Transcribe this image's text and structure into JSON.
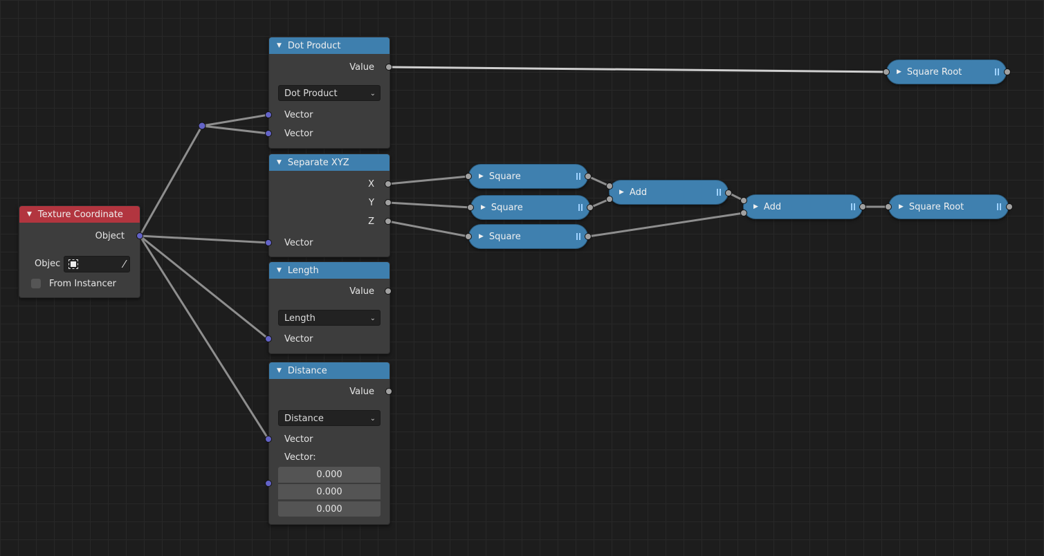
{
  "texture_coordinate": {
    "title": "Texture Coordinate",
    "output_object": "Object",
    "object_label": "Objec",
    "from_instancer_label": "From Instancer",
    "from_instancer_checked": false
  },
  "dot_product": {
    "title": "Dot Product",
    "output_value": "Value",
    "operation": "Dot Product",
    "input_vector_1": "Vector",
    "input_vector_2": "Vector"
  },
  "separate_xyz": {
    "title": "Separate XYZ",
    "out_x": "X",
    "out_y": "Y",
    "out_z": "Z",
    "input_vector": "Vector"
  },
  "length": {
    "title": "Length",
    "output_value": "Value",
    "operation": "Length",
    "input_vector": "Vector"
  },
  "distance": {
    "title": "Distance",
    "output_value": "Value",
    "operation": "Distance",
    "input_vector_1": "Vector",
    "input_vector_2_label": "Vector:",
    "input_vector_2_values": [
      "0.000",
      "0.000",
      "0.000"
    ]
  },
  "collapsed_nodes": {
    "square_root_top": "Square Root",
    "square_x": "Square",
    "square_y": "Square",
    "square_z": "Square",
    "add_1": "Add",
    "add_2": "Add",
    "square_root_bottom": "Square Root"
  },
  "colors": {
    "background": "#1d1d1d",
    "node_body": "#3d3d3d",
    "header_blue": "#3e7fae",
    "header_red": "#b2353f",
    "socket_grey": "#a1a1a1",
    "socket_vector": "#6363c7",
    "wire": "#999999"
  }
}
